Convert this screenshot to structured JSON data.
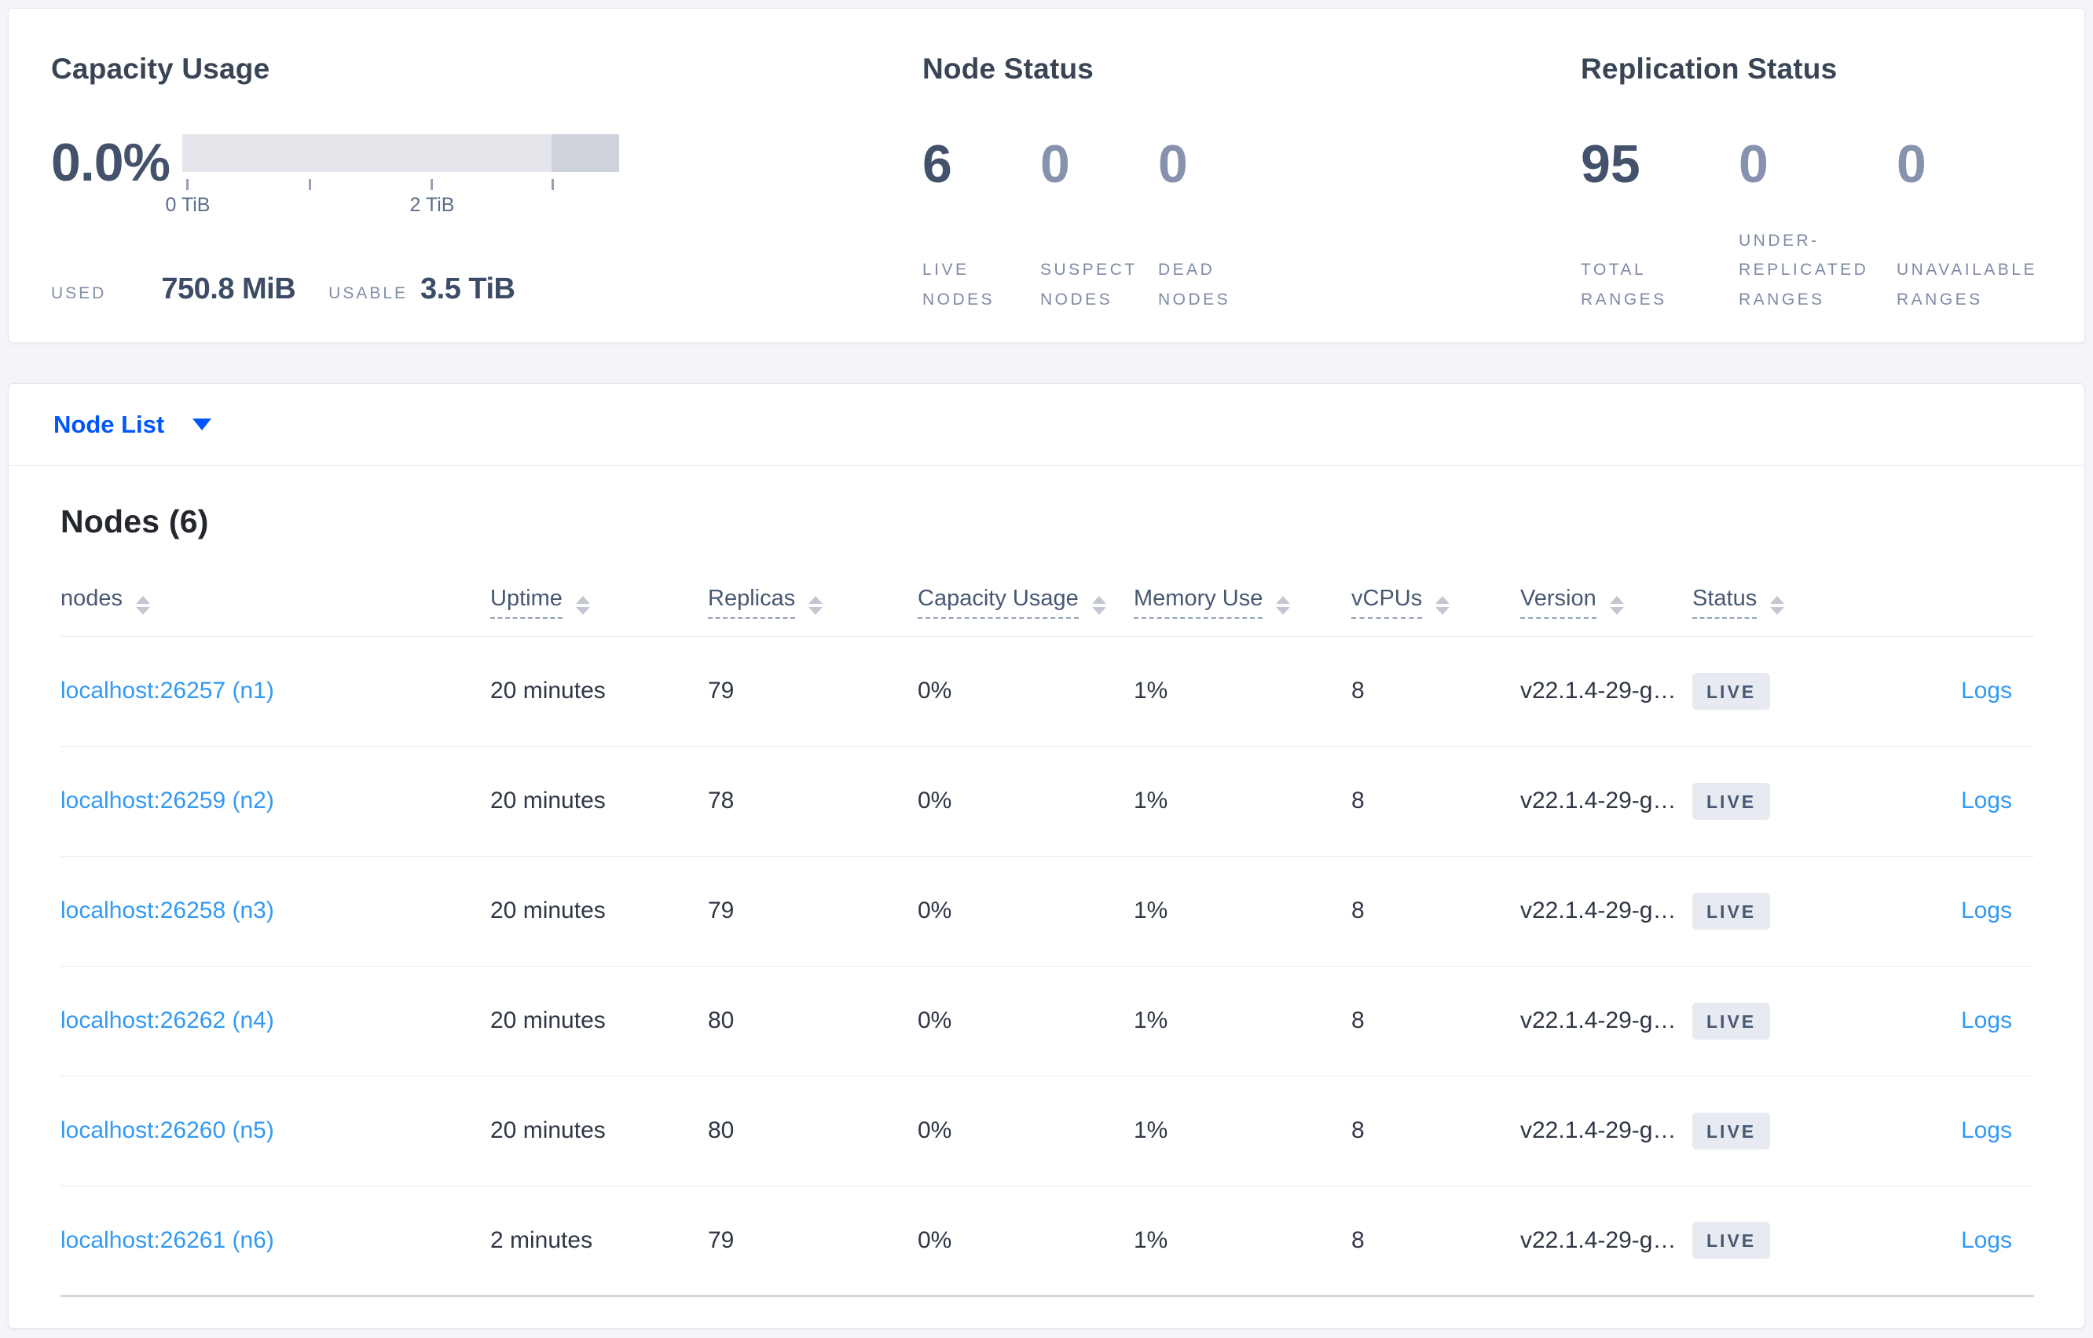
{
  "summary": {
    "capacity": {
      "title": "Capacity Usage",
      "percent": "0.0%",
      "tick_labels": [
        "0 TiB",
        "2 TiB"
      ],
      "axis_ticks_tib": [
        0,
        1,
        2,
        3
      ],
      "used_label": "USED",
      "used_value": "750.8 MiB",
      "usable_label": "USABLE",
      "usable_value": "3.5 TiB"
    },
    "node_status": {
      "title": "Node Status",
      "stats": [
        {
          "value": "6",
          "label": "LIVE NODES"
        },
        {
          "value": "0",
          "label": "SUSPECT NODES"
        },
        {
          "value": "0",
          "label": "DEAD NODES"
        }
      ]
    },
    "replication": {
      "title": "Replication Status",
      "stats": [
        {
          "value": "95",
          "label": "TOTAL RANGES"
        },
        {
          "value": "0",
          "label": "UNDER-REPLICATED RANGES"
        },
        {
          "value": "0",
          "label": "UNAVAILABLE RANGES"
        }
      ]
    }
  },
  "nodelist": {
    "dropdown_label": "Node List"
  },
  "table": {
    "heading": "Nodes (6)",
    "columns": [
      "nodes",
      "Uptime",
      "Replicas",
      "Capacity Usage",
      "Memory Use",
      "vCPUs",
      "Version",
      "Status"
    ],
    "rows": [
      {
        "node": "localhost:26257 (n1)",
        "uptime": "20 minutes",
        "replicas": "79",
        "capacity": "0%",
        "memory": "1%",
        "vcpus": "8",
        "version": "v22.1.4-29-g…",
        "status": "LIVE",
        "logs": "Logs"
      },
      {
        "node": "localhost:26259 (n2)",
        "uptime": "20 minutes",
        "replicas": "78",
        "capacity": "0%",
        "memory": "1%",
        "vcpus": "8",
        "version": "v22.1.4-29-g…",
        "status": "LIVE",
        "logs": "Logs"
      },
      {
        "node": "localhost:26258 (n3)",
        "uptime": "20 minutes",
        "replicas": "79",
        "capacity": "0%",
        "memory": "1%",
        "vcpus": "8",
        "version": "v22.1.4-29-g…",
        "status": "LIVE",
        "logs": "Logs"
      },
      {
        "node": "localhost:26262 (n4)",
        "uptime": "20 minutes",
        "replicas": "80",
        "capacity": "0%",
        "memory": "1%",
        "vcpus": "8",
        "version": "v22.1.4-29-g…",
        "status": "LIVE",
        "logs": "Logs"
      },
      {
        "node": "localhost:26260 (n5)",
        "uptime": "20 minutes",
        "replicas": "80",
        "capacity": "0%",
        "memory": "1%",
        "vcpus": "8",
        "version": "v22.1.4-29-g…",
        "status": "LIVE",
        "logs": "Logs"
      },
      {
        "node": "localhost:26261 (n6)",
        "uptime": "2 minutes",
        "replicas": "79",
        "capacity": "0%",
        "memory": "1%",
        "vcpus": "8",
        "version": "v22.1.4-29-g…",
        "status": "LIVE",
        "logs": "Logs"
      }
    ]
  },
  "colors": {
    "dropdown_blue": "#0055ff",
    "row_link_blue": "#3399f2",
    "stat_dark": "#44516b",
    "stat_light": "#8792ae",
    "badge_bg": "#e7eaf0",
    "bar_light": "#e4e6ec",
    "bar_dark": "#cdd2db"
  }
}
